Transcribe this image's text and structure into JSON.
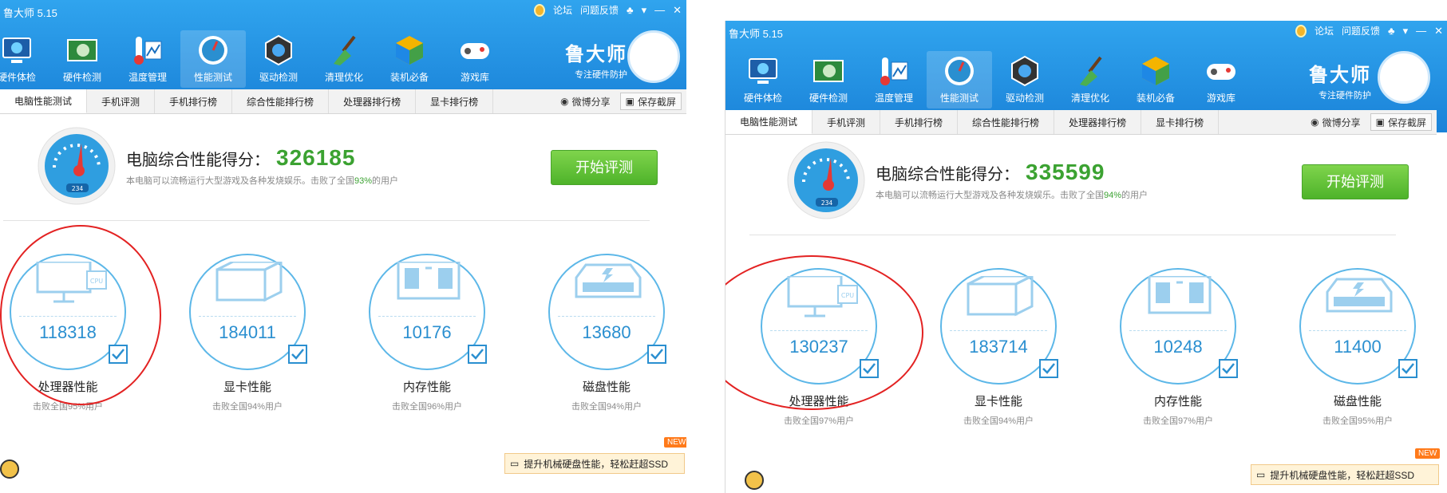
{
  "app": {
    "title": "鲁大师 5.15"
  },
  "window": {
    "forum": "论坛",
    "feedback": "问题反馈"
  },
  "nav": [
    "硬件体检",
    "硬件检测",
    "温度管理",
    "性能测试",
    "驱动检测",
    "清理优化",
    "装机必备",
    "游戏库"
  ],
  "brand": {
    "name": "鲁大师",
    "tagline": "专注硬件防护"
  },
  "subtabs": [
    "电脑性能测试",
    "手机评测",
    "手机排行榜",
    "综合性能排行榜",
    "处理器排行榜",
    "显卡排行榜"
  ],
  "share": "微博分享",
  "save": "保存截屏",
  "start_button": "开始评测",
  "score_title": "电脑综合性能得分：",
  "desc_prefix": "本电脑可以流畅运行大型游戏及各种发烧娱乐。击败了全国",
  "desc_suffix": "的用户",
  "promo": "提升机械硬盘性能，轻松赶超SSD",
  "new_badge": "NEW",
  "metric_names": [
    "处理器性能",
    "显卡性能",
    "内存性能",
    "磁盘性能"
  ],
  "gauge_label": "234",
  "left": {
    "score": "326185",
    "beat": "93%",
    "metrics": [
      {
        "value": "118318",
        "sub": "击败全国95%用户"
      },
      {
        "value": "184011",
        "sub": "击败全国94%用户"
      },
      {
        "value": "10176",
        "sub": "击败全国96%用户"
      },
      {
        "value": "13680",
        "sub": "击败全国94%用户"
      }
    ]
  },
  "right": {
    "score": "335599",
    "beat": "94%",
    "metrics": [
      {
        "value": "130237",
        "sub": "击败全国97%用户"
      },
      {
        "value": "183714",
        "sub": "击败全国94%用户"
      },
      {
        "value": "10248",
        "sub": "击败全国97%用户"
      },
      {
        "value": "11400",
        "sub": "击败全国95%用户"
      }
    ]
  },
  "colors": {
    "blue": "#1a82d8",
    "green": "#3ba231",
    "ring": "#5cb7e8",
    "annotation_red": "#e32222"
  },
  "icons": [
    "medal-icon",
    "skin-icon",
    "menu-icon",
    "minimize-icon",
    "close-icon",
    "weibo-icon",
    "camera-icon",
    "cpu-icon",
    "gpu-icon",
    "memory-icon",
    "disk-icon",
    "check-icon",
    "speed-gauge-icon"
  ]
}
